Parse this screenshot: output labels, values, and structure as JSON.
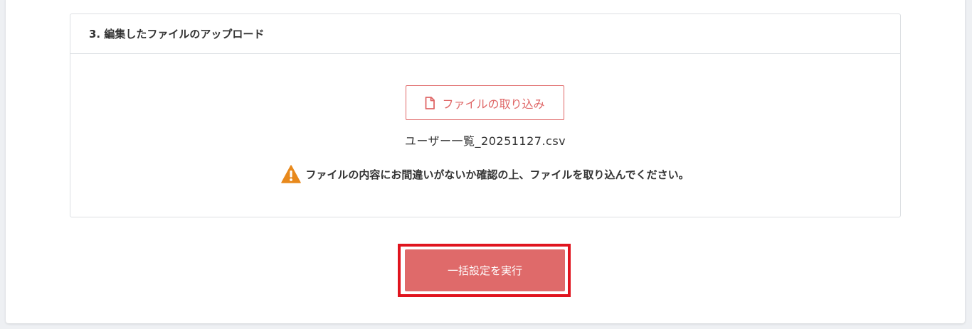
{
  "section": {
    "title": "3. 編集したファイルのアップロード"
  },
  "import_button": {
    "label": "ファイルの取り込み",
    "icon": "file-icon"
  },
  "file": {
    "name": "ユーザー一覧_20251127.csv"
  },
  "warning": {
    "icon": "warning-icon",
    "message": "ファイルの内容にお間違いがないか確認の上、ファイルを取り込んでください。"
  },
  "execute_button": {
    "label": "一括設定を実行"
  },
  "colors": {
    "accent": "#df6666",
    "button_fill": "#df6a6a",
    "highlight_outline": "#e0141e",
    "warning": "#e8891c"
  }
}
